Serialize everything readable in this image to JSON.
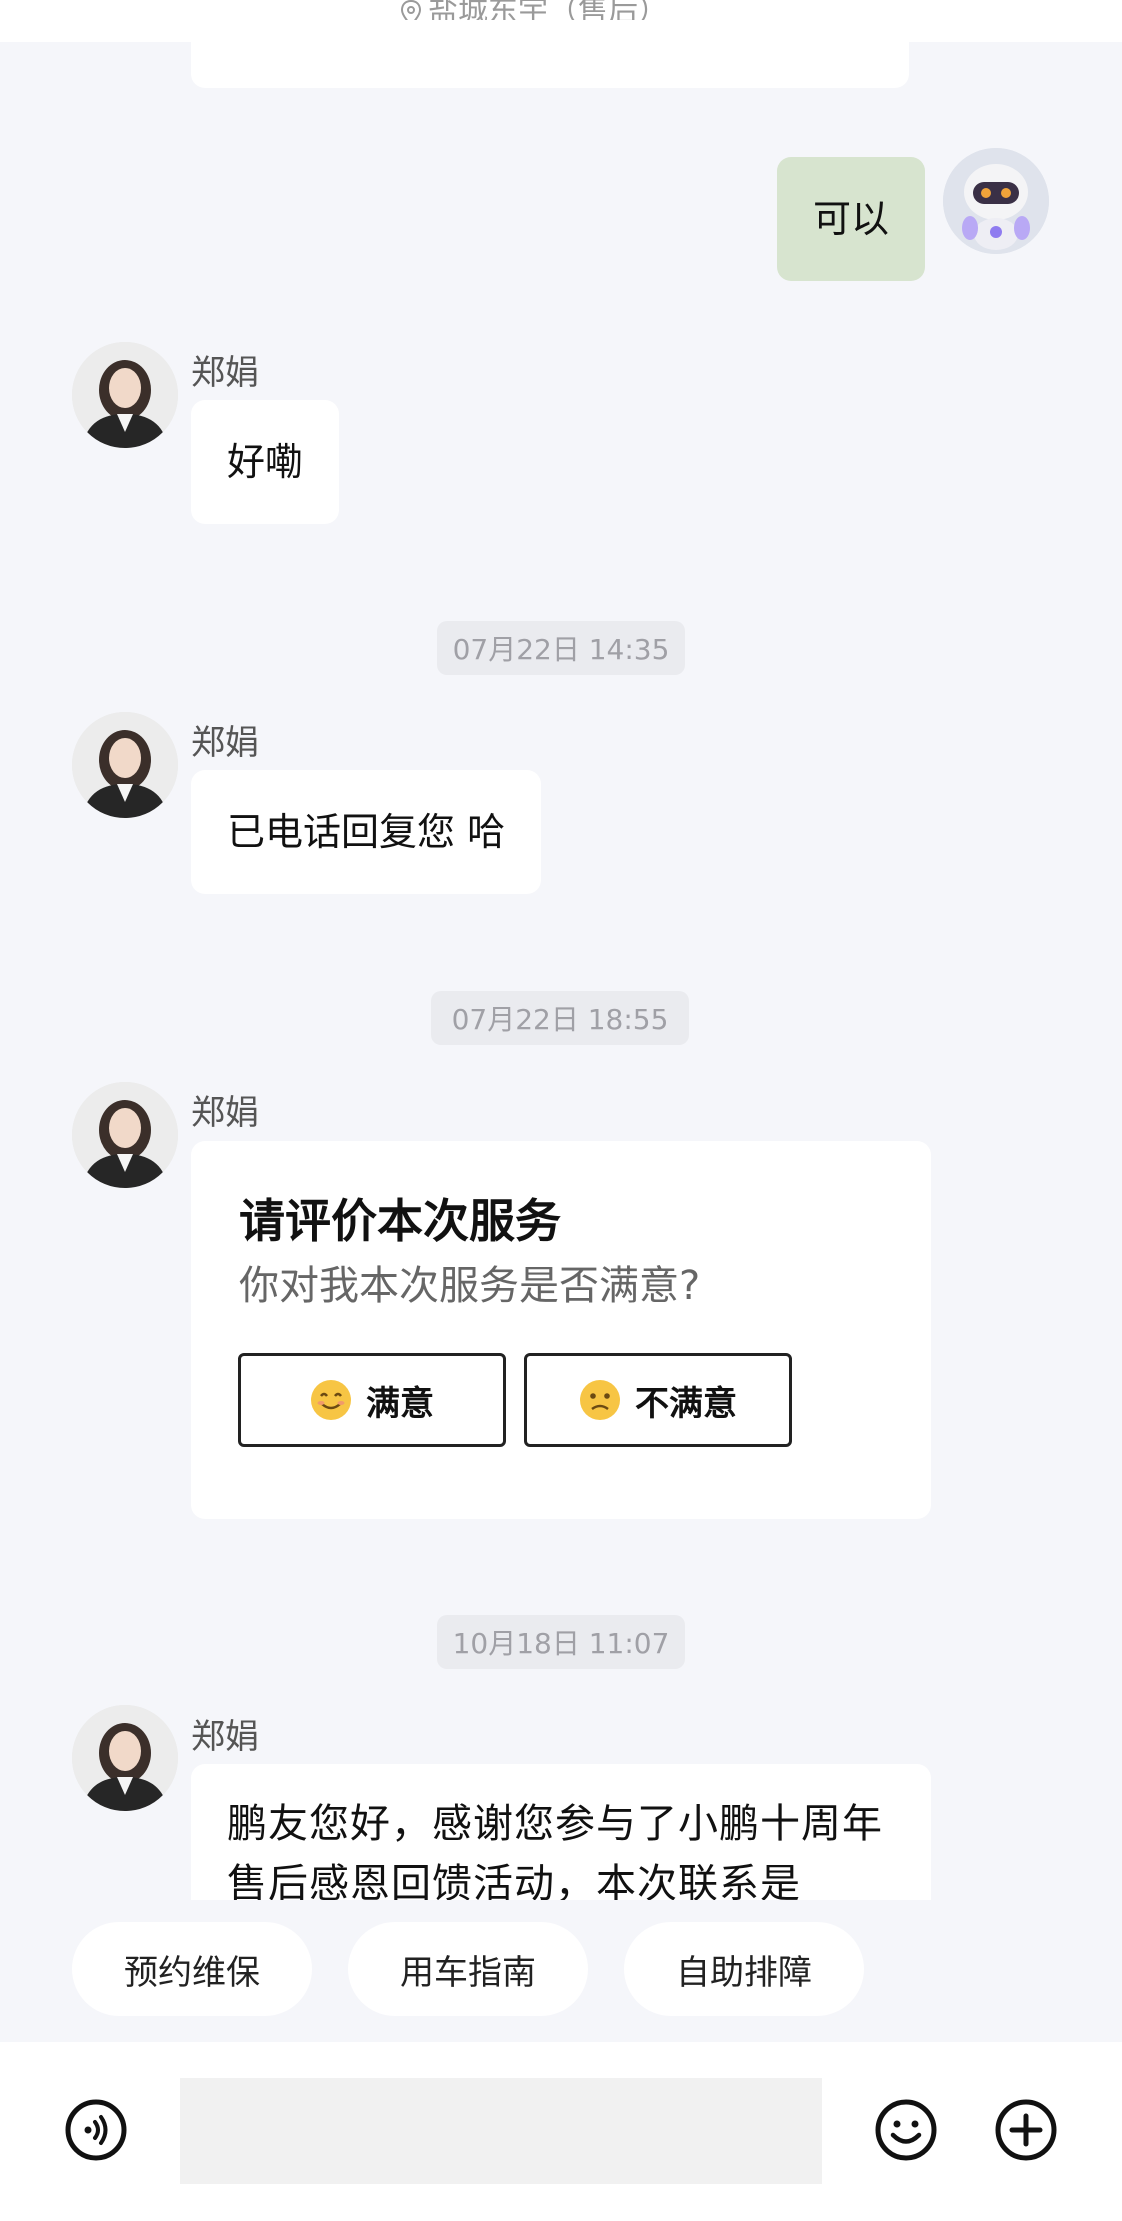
{
  "header": {
    "location": "盐城东宇（售后）"
  },
  "messages": [
    {
      "type": "self",
      "text": "可以"
    },
    {
      "type": "agent",
      "sender": "郑娟",
      "text": "好嘞"
    },
    {
      "type": "time",
      "text": "07月22日 14:35"
    },
    {
      "type": "agent",
      "sender": "郑娟",
      "text": "已电话回复您 哈"
    },
    {
      "type": "time",
      "text": "07月22日 18:55"
    },
    {
      "type": "agent",
      "sender": "郑娟"
    },
    {
      "type": "time",
      "text": "10月18日 11:07"
    },
    {
      "type": "agent",
      "sender": "郑娟",
      "text": "鹏友您好，感谢您参与了小鹏十周年售后感恩回馈活动，本次联系是"
    }
  ],
  "rating_card": {
    "title": "请评价本次服务",
    "subtitle": "你对我本次服务是否满意?",
    "satisfied_label": "满意",
    "unsatisfied_label": "不满意"
  },
  "quick_actions": [
    "预约维保",
    "用车指南",
    "自助排障"
  ],
  "input": {
    "placeholder": ""
  },
  "colors": {
    "background": "#f5f6fa",
    "self_bubble": "#d7e4cf",
    "agent_bubble": "#ffffff"
  }
}
